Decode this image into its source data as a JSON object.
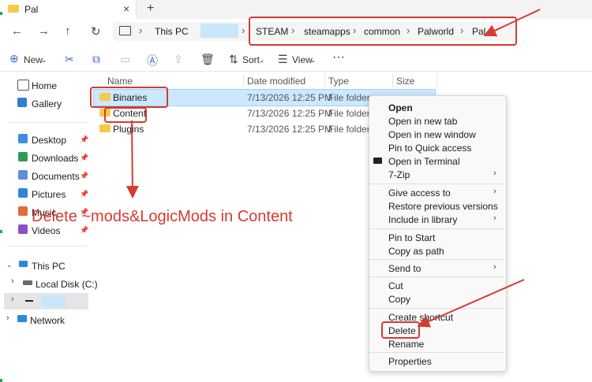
{
  "tab": {
    "title": "Pal"
  },
  "address": {
    "this_pc": "This PC",
    "crumbs": [
      "STEAM",
      "steamapps",
      "common",
      "Palworld",
      "Pal"
    ]
  },
  "toolbar": {
    "new_label": "New",
    "sort_label": "Sort",
    "view_label": "View"
  },
  "sidebar": {
    "top": [
      {
        "label": "Home",
        "icon": "home-icon"
      },
      {
        "label": "Gallery",
        "icon": "gallery-icon"
      }
    ],
    "quick": [
      {
        "label": "Desktop",
        "icon": "desktop-icon"
      },
      {
        "label": "Downloads",
        "icon": "downloads-icon"
      },
      {
        "label": "Documents",
        "icon": "documents-icon"
      },
      {
        "label": "Pictures",
        "icon": "pictures-icon"
      },
      {
        "label": "Music",
        "icon": "music-icon"
      },
      {
        "label": "Videos",
        "icon": "videos-icon"
      }
    ],
    "this_pc": "This PC",
    "local_disk": "Local Disk (C:)",
    "network": "Network"
  },
  "columns": {
    "name": "Name",
    "date": "Date modified",
    "type": "Type",
    "size": "Size"
  },
  "files": [
    {
      "name": "Binaries",
      "date": "7/13/2026 12:25 PM",
      "type": "File folder"
    },
    {
      "name": "Content",
      "date": "7/13/2026 12:25 PM",
      "type": "File folder"
    },
    {
      "name": "Plugins",
      "date": "7/13/2026 12:25 PM",
      "type": "File folder"
    }
  ],
  "context_menu": {
    "open": "Open",
    "open_new_tab": "Open in new tab",
    "open_new_window": "Open in new window",
    "pin_quick": "Pin to Quick access",
    "open_terminal": "Open in Terminal",
    "zip": "7-Zip",
    "give_access": "Give access to",
    "restore": "Restore previous versions",
    "include_library": "Include in library",
    "pin_start": "Pin to Start",
    "copy_path": "Copy as path",
    "send_to": "Send to",
    "cut": "Cut",
    "copy": "Copy",
    "create_shortcut": "Create shortcut",
    "delete": "Delete",
    "rename": "Rename",
    "properties": "Properties"
  },
  "annotation": {
    "text": "Delete ~mods&LogicMods in Content"
  },
  "colors": {
    "annotation_red": "#d63a31",
    "folder_yellow": "#f6c94a",
    "selection_blue": "#cce8ff"
  }
}
